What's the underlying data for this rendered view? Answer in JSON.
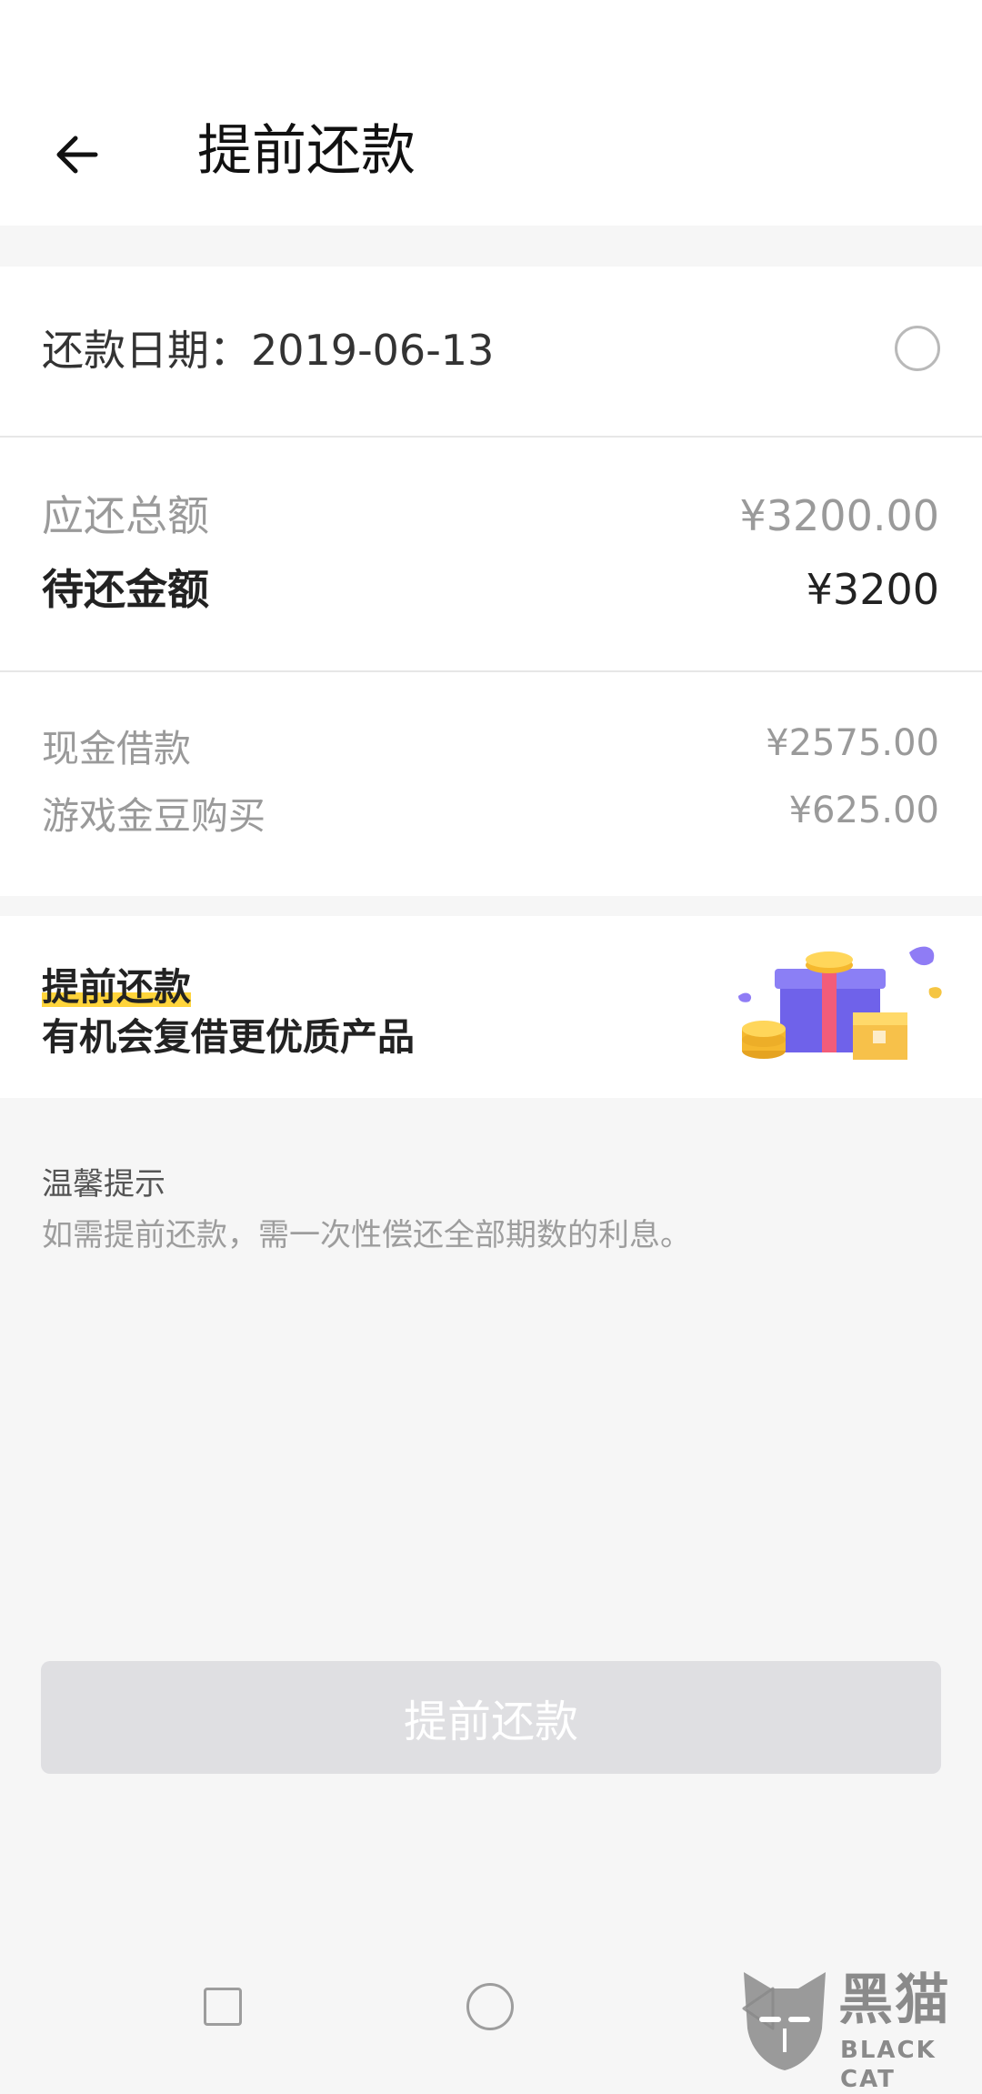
{
  "header": {
    "title": "提前还款",
    "back_icon": "arrow-left-icon"
  },
  "repay_date": {
    "label": "还款日期：2019-06-13"
  },
  "totals": {
    "total_due_label": "应还总额",
    "total_due_value": "¥3200.00",
    "pending_label": "待还金额",
    "pending_value": "¥3200"
  },
  "items": [
    {
      "label": "现金借款",
      "value": "¥2575.00"
    },
    {
      "label": "游戏金豆购买",
      "value": "¥625.00"
    }
  ],
  "promo": {
    "title": "提前还款",
    "subtitle": "有机会复借更优质产品",
    "icon": "gift-box-coins-icon"
  },
  "tips": {
    "title": "温馨提示",
    "text": "如需提前还款，需一次性偿还全部期数的利息。"
  },
  "action_button": {
    "label": "提前还款"
  },
  "watermark": {
    "text": "黑猫",
    "sub": "BLACK CAT"
  },
  "colors": {
    "highlight": "#ffd43b",
    "button_disabled": "#dfdfe2",
    "gift_purple": "#7a6cf2",
    "coin_gold": "#f5b82e"
  }
}
